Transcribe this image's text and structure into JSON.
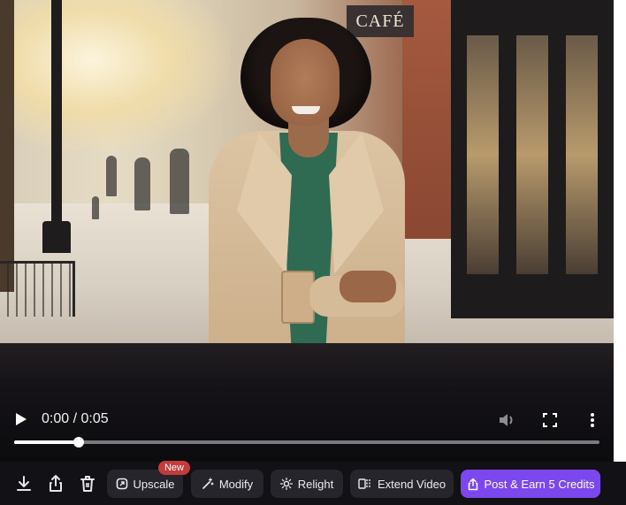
{
  "scene": {
    "sign_text": "CAFÉ"
  },
  "player": {
    "time_display": "0:00 / 0:05",
    "progress": 0.11,
    "controls": [
      "play-icon",
      "volume-icon",
      "fullscreen-icon",
      "more-vertical-icon"
    ]
  },
  "toolbar": {
    "icons": [
      "download-icon",
      "share-icon",
      "trash-icon"
    ],
    "upscale_label": "Upscale",
    "new_badge": "New",
    "modify_label": "Modify",
    "relight_label": "Relight",
    "extend_label": "Extend Video",
    "post_label": "Post & Earn 5 Credits"
  },
  "colors": {
    "accent": "#7c48ee",
    "badge": "#c43b3b",
    "toolbar_bg": "#121116",
    "button_bg": "#26252b"
  }
}
